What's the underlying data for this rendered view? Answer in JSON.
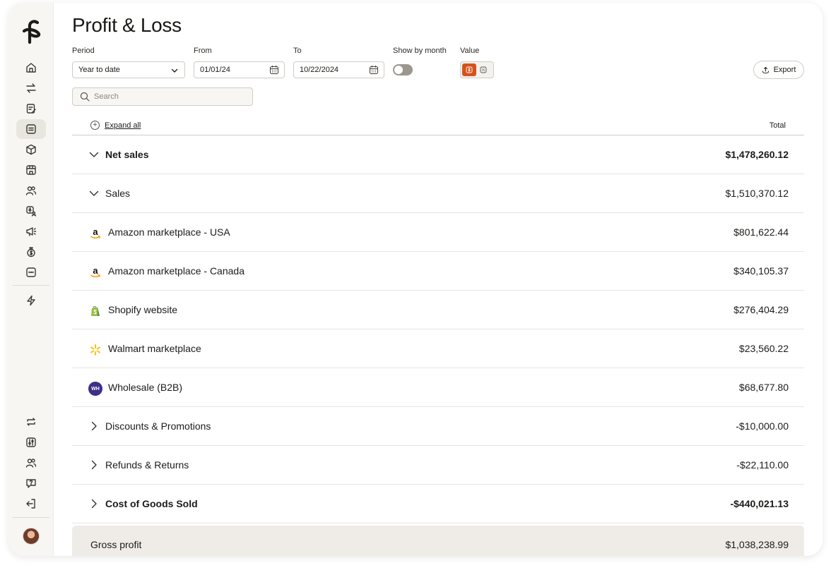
{
  "page": {
    "title": "Profit & Loss"
  },
  "filters": {
    "period_label": "Period",
    "period_value": "Year to date",
    "from_label": "From",
    "from_value": "01/01/24",
    "to_label": "To",
    "to_value": "10/22/2024",
    "show_by_month_label": "Show by month",
    "show_by_month_on": false,
    "value_label": "Value",
    "value_mode": "dollar"
  },
  "export_label": "Export",
  "search": {
    "placeholder": "Search"
  },
  "table": {
    "expand_all_label": "Expand all",
    "total_label": "Total",
    "rows": [
      {
        "label": "Net sales",
        "amount": "$1,478,260.12",
        "expandable": "expanded",
        "bold": true
      },
      {
        "label": "Sales",
        "amount": "$1,510,370.12",
        "expandable": "expanded",
        "bold": false
      },
      {
        "label": "Amazon marketplace - USA",
        "amount": "$801,622.44",
        "icon": "amazon-icon"
      },
      {
        "label": "Amazon marketplace - Canada",
        "amount": "$340,105.37",
        "icon": "amazon-icon"
      },
      {
        "label": "Shopify website",
        "amount": "$276,404.29",
        "icon": "shopify-icon"
      },
      {
        "label": "Walmart marketplace",
        "amount": "$23,560.22",
        "icon": "walmart-icon"
      },
      {
        "label": "Wholesale (B2B)",
        "amount": "$68,677.80",
        "icon": "wholesale-badge",
        "badge_text": "WH"
      },
      {
        "label": "Discounts & Promotions",
        "amount": "-$10,000.00",
        "expandable": "collapsed"
      },
      {
        "label": "Refunds & Returns",
        "amount": "-$22,110.00",
        "expandable": "collapsed"
      },
      {
        "label": "Cost of Goods Sold",
        "amount": "-$440,021.13",
        "expandable": "collapsed",
        "bold": true
      },
      {
        "label": "Gross profit",
        "amount": "$1,038,238.99",
        "summary": true
      }
    ]
  },
  "colors": {
    "accent": "#d4531c",
    "sidebar_bg": "#f7f6f3",
    "summary_row_bg": "#efece8",
    "wholesale_badge": "#3b2f86"
  }
}
